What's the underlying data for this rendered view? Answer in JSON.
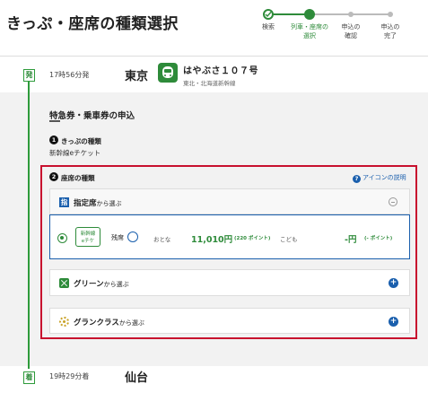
{
  "header": {
    "title": "きっぷ・座席の種類選択",
    "steps": [
      {
        "label": "検索",
        "state": "done"
      },
      {
        "label": "列車・座席の\n選択",
        "state": "current"
      },
      {
        "label": "申込の\n確認",
        "state": "todo"
      },
      {
        "label": "申込の\n完了",
        "state": "todo"
      }
    ]
  },
  "departure": {
    "badge": "発",
    "time": "17時56分発",
    "station": "東京",
    "train_name": "はやぶさ１０７号",
    "line": "東北・北海道新幹線",
    "train_icon": "train-icon"
  },
  "application": {
    "title": "特急券・乗車券の申込",
    "ticket_kind": {
      "number": "1",
      "label": "きっぷの種類",
      "value": "新幹線eチケット"
    },
    "seat_kind": {
      "number": "2",
      "label": "座席の種類"
    },
    "icon_help": "アイコンの説明"
  },
  "seat_panels": {
    "reserved": {
      "tag": "指",
      "label": "指定席",
      "suffix": "から選ぶ"
    },
    "option": {
      "badge_line1": "新幹線",
      "badge_line2": "eチケ",
      "remaining_label": "残席",
      "adult_label": "おとな",
      "adult_fare": "11,010円",
      "adult_points": "(220 ポイント)",
      "child_label": "こども",
      "child_fare": "-円",
      "child_points": "(- ポイント)"
    },
    "green": {
      "label": "グリーン",
      "suffix": "から選ぶ"
    },
    "granclass": {
      "label": "グランクラス",
      "suffix": "から選ぶ"
    }
  },
  "arrival": {
    "badge": "着",
    "time": "19時29分着",
    "station": "仙台"
  },
  "colors": {
    "accent_green": "#2e8b3a",
    "accent_blue": "#1a5fad",
    "highlight_red": "#c8102e"
  }
}
